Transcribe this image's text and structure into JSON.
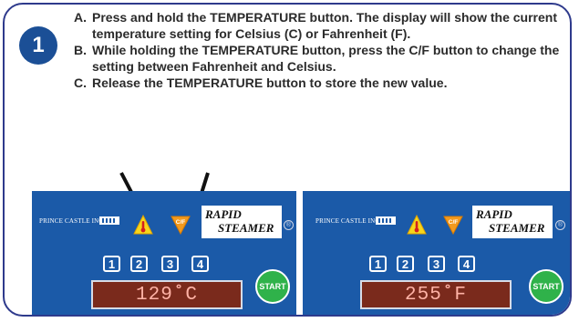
{
  "step_number": "1",
  "instructions": [
    {
      "letter": "A.",
      "text": "Press and hold the TEMPERATURE button. The display will show the current temperature setting for Celsius (C) or Fahrenheit (F)."
    },
    {
      "letter": "B.",
      "text": "While holding the TEMPERATURE button, press the C/F button to change the setting between Fahrenheit and Celsius."
    },
    {
      "letter": "C.",
      "text": "Release the TEMPERATURE button to store the new value."
    }
  ],
  "panels": [
    {
      "brand": "PRINCE CASTLE INC.",
      "logo_line1": "RAPID",
      "logo_line2": "STEAMER",
      "registered": "®",
      "cf_label": "C/F",
      "number_keys": [
        "1",
        "2",
        "3",
        "4"
      ],
      "display": "129˚C",
      "start_label": "START"
    },
    {
      "brand": "PRINCE CASTLE INC.",
      "logo_line1": "RAPID",
      "logo_line2": "STEAMER",
      "registered": "®",
      "cf_label": "C/F",
      "number_keys": [
        "1",
        "2",
        "3",
        "4"
      ],
      "display": "255˚F",
      "start_label": "START"
    }
  ],
  "colors": {
    "card_border": "#2e3a8c",
    "badge": "#1b4f96",
    "panel": "#1b5aa8",
    "warning_yellow": "#f7d61b",
    "cf_orange": "#f39a1e",
    "display_bg": "#7a2a1c",
    "start_green": "#2fb24a"
  },
  "icons": [
    "thermometer-icon",
    "cf-icon",
    "arrow-icon"
  ]
}
